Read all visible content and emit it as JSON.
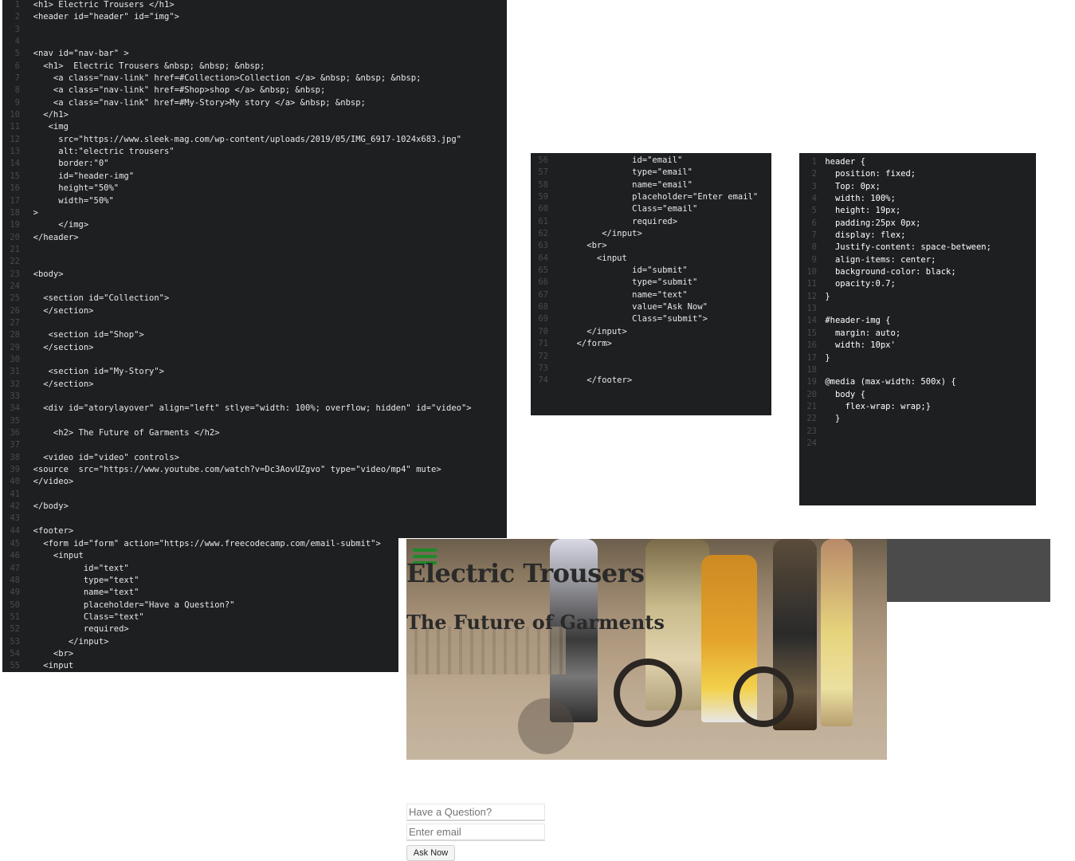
{
  "html_panel": {
    "lines": [
      [
        "1",
        "  <h1> Electric Trousers </h1>"
      ],
      [
        "2",
        "  <header id=\"header\" id=\"img\">"
      ],
      [
        "3",
        ""
      ],
      [
        "4",
        ""
      ],
      [
        "5",
        "  <nav id=\"nav-bar\" >"
      ],
      [
        "6",
        "    <h1>  Electric Trousers &nbsp; &nbsp; &nbsp;"
      ],
      [
        "7",
        "      <a class=\"nav-link\" href=#Collection>Collection </a> &nbsp; &nbsp; &nbsp;"
      ],
      [
        "8",
        "      <a class=\"nav-link\" href=#Shop>shop </a> &nbsp; &nbsp;"
      ],
      [
        "9",
        "      <a class=\"nav-link\" href=#My-Story>My story </a> &nbsp; &nbsp;"
      ],
      [
        "10",
        "    </h1>"
      ],
      [
        "11",
        "     <img"
      ],
      [
        "12",
        "       src=\"https://www.sleek-mag.com/wp-content/uploads/2019/05/IMG_6917-1024x683.jpg\""
      ],
      [
        "13",
        "       alt:\"electric trousers\""
      ],
      [
        "14",
        "       border:\"0\""
      ],
      [
        "15",
        "       id=\"header-img\""
      ],
      [
        "16",
        "       height=\"50%\""
      ],
      [
        "17",
        "       width=\"50%\""
      ],
      [
        "18",
        "  >"
      ],
      [
        "19",
        "       </img>"
      ],
      [
        "20",
        "  </header>"
      ],
      [
        "21",
        ""
      ],
      [
        "22",
        ""
      ],
      [
        "23",
        "  <body>"
      ],
      [
        "24",
        ""
      ],
      [
        "25",
        "    <section id=\"Collection\">"
      ],
      [
        "26",
        "    </section>"
      ],
      [
        "27",
        ""
      ],
      [
        "28",
        "     <section id=\"Shop\">"
      ],
      [
        "29",
        "    </section>"
      ],
      [
        "30",
        ""
      ],
      [
        "31",
        "     <section id=\"My-Story\">"
      ],
      [
        "32",
        "    </section>"
      ],
      [
        "33",
        ""
      ],
      [
        "34",
        "    <div id=\"atorylayover\" align=\"left\" stlye=\"width: 100%; overflow; hidden\" id=\"video\">"
      ],
      [
        "35",
        ""
      ],
      [
        "36",
        "      <h2> The Future of Garments </h2>"
      ],
      [
        "37",
        ""
      ],
      [
        "38",
        "    <video id=\"video\" controls>"
      ],
      [
        "39",
        "  <source  src=\"https://www.youtube.com/watch?v=Dc3AovUZgvo\" type=\"video/mp4\" mute>"
      ],
      [
        "40",
        "  </video>"
      ],
      [
        "41",
        ""
      ],
      [
        "42",
        "  </body>"
      ],
      [
        "43",
        ""
      ],
      [
        "44",
        "  <footer>"
      ]
    ],
    "lines_bottom": [
      [
        "45",
        "    <form id=\"form\" action=\"https://www.freecodecamp.com/email-submit\">"
      ],
      [
        "46",
        "      <input"
      ],
      [
        "47",
        "            id=\"text\""
      ],
      [
        "48",
        "            type=\"text\""
      ],
      [
        "49",
        "            name=\"text\""
      ],
      [
        "50",
        "            placeholder=\"Have a Question?\""
      ],
      [
        "51",
        "            Class=\"text\""
      ],
      [
        "52",
        "            required>"
      ],
      [
        "53",
        "         </input>"
      ],
      [
        "54",
        "      <br>"
      ],
      [
        "55",
        "    <input"
      ]
    ]
  },
  "footer_panel": {
    "lines": [
      [
        "56",
        "                id=\"email\""
      ],
      [
        "57",
        "                type=\"email\""
      ],
      [
        "58",
        "                name=\"email\""
      ],
      [
        "59",
        "                placeholder=\"Enter email\""
      ],
      [
        "60",
        "                Class=\"email\""
      ],
      [
        "61",
        "                required>"
      ],
      [
        "62",
        "          </input>"
      ],
      [
        "63",
        "       <br>"
      ],
      [
        "64",
        "         <input"
      ],
      [
        "65",
        "                id=\"submit\""
      ],
      [
        "66",
        "                type=\"submit\""
      ],
      [
        "67",
        "                name=\"text\""
      ],
      [
        "68",
        "                value=\"Ask Now\""
      ],
      [
        "69",
        "                Class=\"submit\">"
      ],
      [
        "70",
        "       </input>"
      ],
      [
        "71",
        "     </form>"
      ],
      [
        "72",
        ""
      ],
      [
        "73",
        ""
      ],
      [
        "74",
        "       </footer>"
      ]
    ]
  },
  "css_panel": {
    "lines": [
      [
        "1",
        " header {"
      ],
      [
        "2",
        "   position: fixed;"
      ],
      [
        "3",
        "   Top: 0px;"
      ],
      [
        "4",
        "   width: 100%;"
      ],
      [
        "5",
        "   height: 19px;"
      ],
      [
        "6",
        "   padding:25px 0px;"
      ],
      [
        "7",
        "   display: flex;"
      ],
      [
        "8",
        "   Justify-content: space-between;"
      ],
      [
        "9",
        "   align-items: center;"
      ],
      [
        "10",
        "   background-color: black;"
      ],
      [
        "11",
        "   opacity:0.7;"
      ],
      [
        "12",
        " }"
      ],
      [
        "13",
        ""
      ],
      [
        "14",
        " #header-img {"
      ],
      [
        "15",
        "   margin: auto;"
      ],
      [
        "16",
        "   width: 10px'"
      ],
      [
        "17",
        " }"
      ],
      [
        "18",
        ""
      ],
      [
        "19",
        " @media (max-width: 500x) {"
      ],
      [
        "20",
        "   body {"
      ],
      [
        "21",
        "     flex-wrap: wrap;}"
      ],
      [
        "22",
        "   }"
      ],
      [
        "23",
        ""
      ],
      [
        "24",
        ""
      ]
    ]
  },
  "preview": {
    "title": "Electric Trousers",
    "subtitle": "The Future of Garments",
    "menu_icon": "hamburger-icon",
    "accent_green": "#1f8a2a"
  },
  "form": {
    "question_placeholder": "Have a Question?",
    "email_placeholder": "Enter email",
    "submit_label": "Ask Now"
  }
}
